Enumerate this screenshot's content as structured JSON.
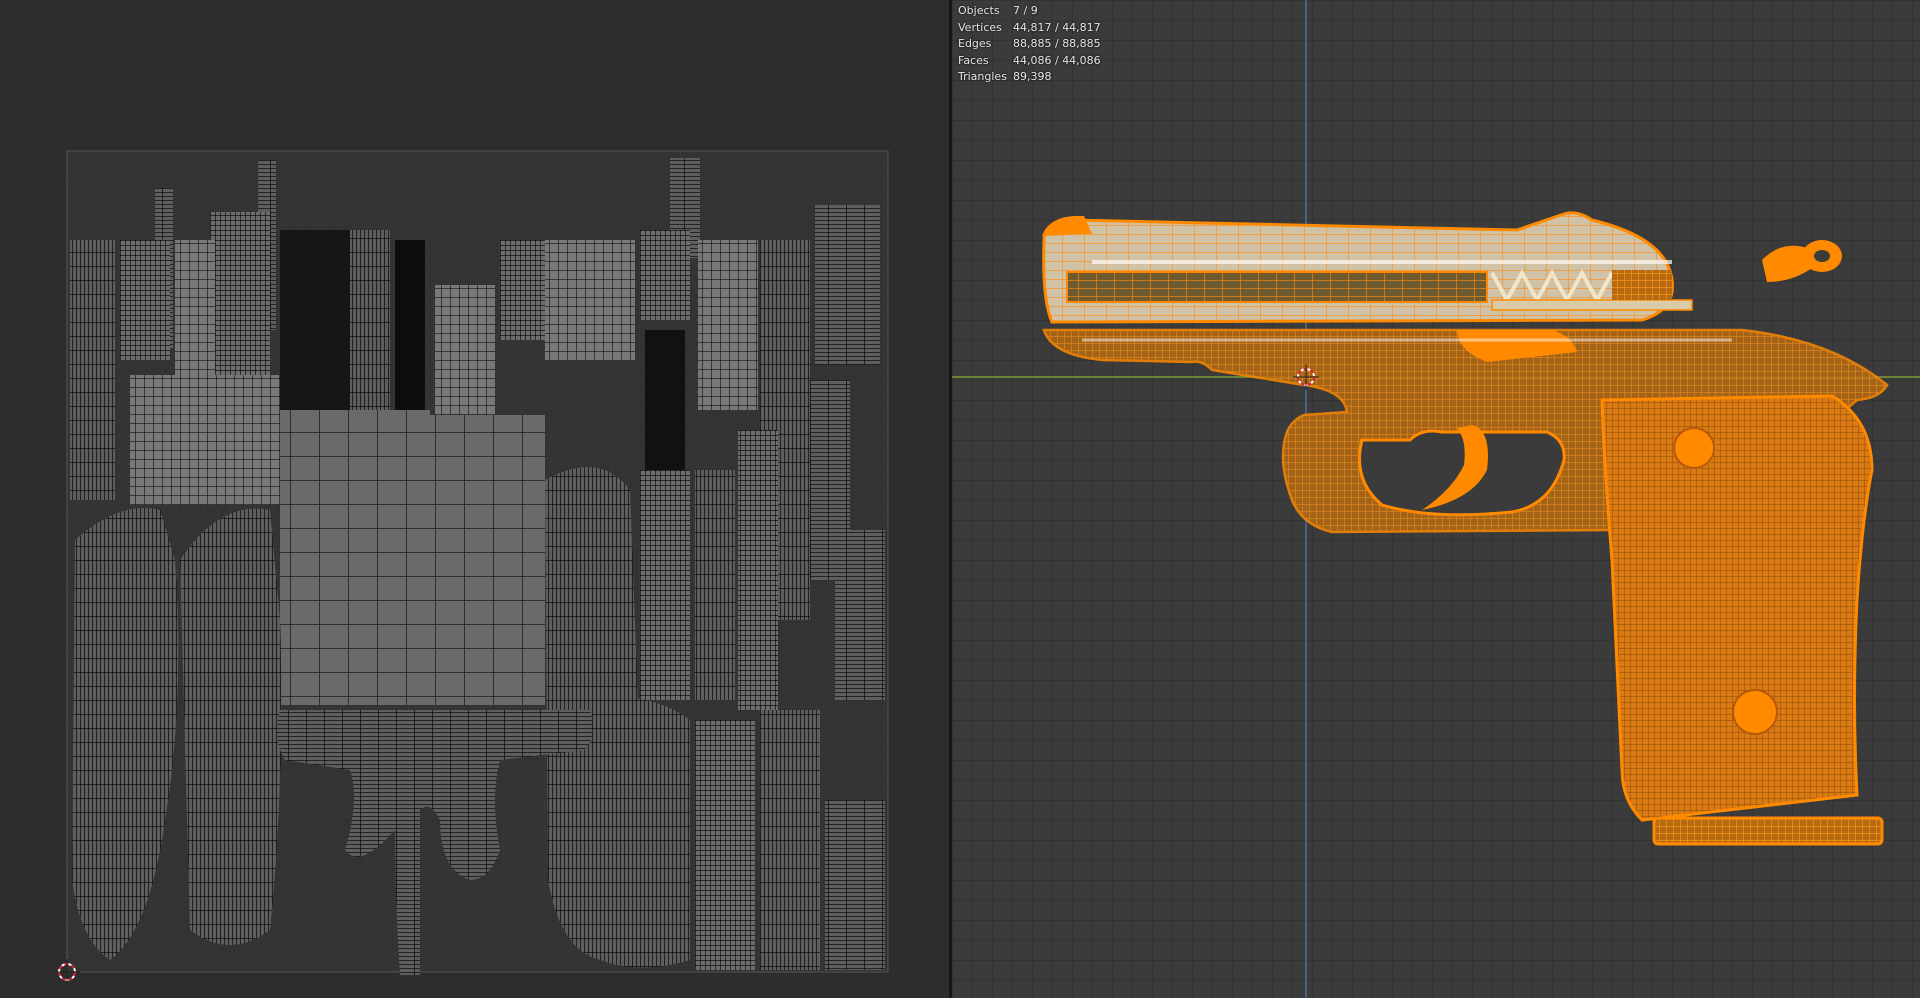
{
  "uv_editor": {
    "cursor_icon": "cursor-crosshair-icon"
  },
  "viewport": {
    "stats": [
      {
        "label": "Objects",
        "value": "7 / 9"
      },
      {
        "label": "Vertices",
        "value": "44,817 / 44,817"
      },
      {
        "label": "Edges",
        "value": "88,885 / 88,885"
      },
      {
        "label": "Faces",
        "value": "44,086 / 44,086"
      },
      {
        "label": "Triangles",
        "value": "89,398"
      }
    ],
    "cursor_icon": "3d-cursor-icon",
    "selection_color": "#ff8a00"
  },
  "colors": {
    "uv_background": "#2d2d2d",
    "uv_grid": "#3a3a3a",
    "uv_mesh": "#000000",
    "uv_face": "#7a7a7a",
    "viewport_background": "#3b3b3b",
    "axis_x": "#7c9a36",
    "axis_y": "#4f6f9c"
  }
}
